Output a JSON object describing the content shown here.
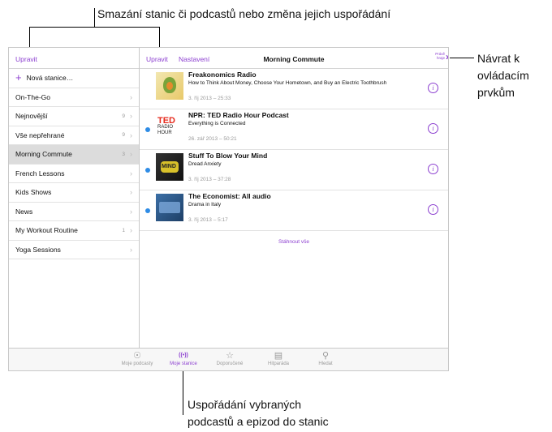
{
  "callouts": {
    "top": "Smazání stanic či podcastů nebo změna jejich uspořádání",
    "right": [
      "Návrat k",
      "ovládacím",
      "prvkům"
    ],
    "bottom": [
      "Uspořádání vybraných",
      "podcastů a epizod do stanic"
    ]
  },
  "sidebar": {
    "edit": "Upravit",
    "new_station": "Nová stanice…",
    "items": [
      {
        "label": "On-The-Go",
        "count": ""
      },
      {
        "label": "Nejnovější",
        "count": "9"
      },
      {
        "label": "Vše nepřehrané",
        "count": "9"
      },
      {
        "label": "Morning Commute",
        "count": "3"
      },
      {
        "label": "French Lessons",
        "count": ""
      },
      {
        "label": "Kids Shows",
        "count": ""
      },
      {
        "label": "News",
        "count": ""
      },
      {
        "label": "My Workout Routine",
        "count": "1"
      },
      {
        "label": "Yoga Sessions",
        "count": ""
      }
    ]
  },
  "main": {
    "edit": "Upravit",
    "settings": "Nastavení",
    "title": "Morning Commute",
    "now_playing": [
      "Právě",
      "hraje"
    ],
    "episodes": [
      {
        "title": "Freakonomics Radio",
        "subtitle": "How to Think About Money, Choose Your Hometown, and Buy an Electric Toothbrush",
        "date": "3. říj 2013 – 25:33",
        "unplayed": false,
        "art": {
          "label": ""
        }
      },
      {
        "title": "NPR: TED Radio Hour Podcast",
        "subtitle": "Everything is Connected",
        "date": "26. zář 2013 – 50:21",
        "unplayed": true,
        "art": {
          "label": "TED",
          "sub1": "RADIO",
          "sub2": "HOUR"
        }
      },
      {
        "title": "Stuff To Blow Your Mind",
        "subtitle": "Dread Anxiety",
        "date": "3. říj 2013 – 37:28",
        "unplayed": true,
        "art": {
          "label": "MIND"
        }
      },
      {
        "title": "The Economist: All audio",
        "subtitle": "Drama in Italy",
        "date": "3. říj 2013 – 5:17",
        "unplayed": true,
        "art": {
          "label": ""
        }
      }
    ],
    "download_all": "Stáhnout vše"
  },
  "tabs": [
    {
      "label": "Moje podcasty",
      "icon": "podcast-icon",
      "active": false
    },
    {
      "label": "Moje stanice",
      "icon": "station-icon",
      "active": true
    },
    {
      "label": "Doporučené",
      "icon": "star-icon",
      "active": false
    },
    {
      "label": "Hitparáda",
      "icon": "list-icon",
      "active": false
    },
    {
      "label": "Hledat",
      "icon": "search-icon",
      "active": false
    }
  ],
  "colors": {
    "accent": "#8c3fd0",
    "unplayed_dot": "#2e8ce6"
  }
}
